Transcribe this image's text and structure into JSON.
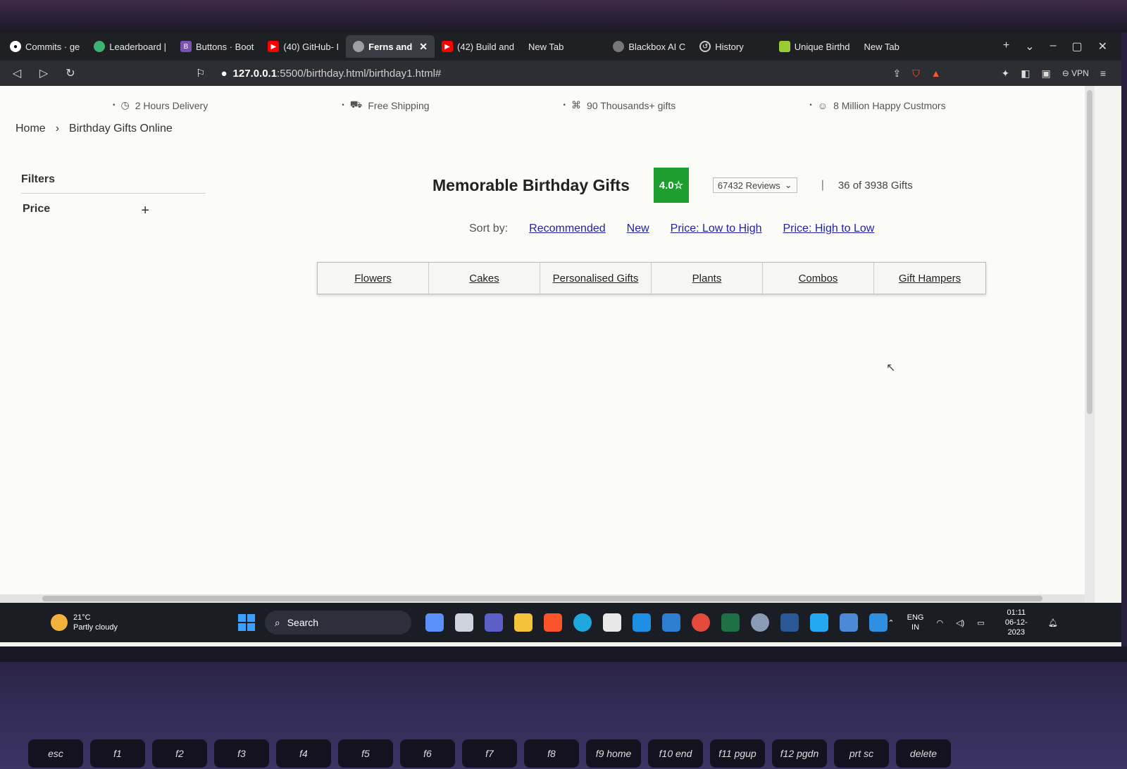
{
  "browser": {
    "tabs": [
      {
        "label": "Commits · ge",
        "icon": "github-icon",
        "color": "#ffffff"
      },
      {
        "label": "Leaderboard |",
        "icon": "leaderboard-icon",
        "color": "#3cb371"
      },
      {
        "label": "Buttons · Boot",
        "icon": "bootstrap-icon",
        "color": "#7952b3"
      },
      {
        "label": "(40) GitHub- I",
        "icon": "youtube-icon",
        "color": "#ff0000"
      },
      {
        "label": "Ferns and",
        "icon": "globe-icon",
        "color": "#9aa0a6",
        "active": true
      },
      {
        "label": "(42) Build and",
        "icon": "youtube-icon",
        "color": "#ff0000"
      },
      {
        "label": "New Tab",
        "icon": "",
        "color": ""
      },
      {
        "label": "Blackbox AI C",
        "icon": "blackbox-icon",
        "color": "#cccccc"
      },
      {
        "label": "History",
        "icon": "history-icon",
        "color": "#cccccc"
      },
      {
        "label": "Unique Birthd",
        "icon": "fnp-icon",
        "color": "#9acd32"
      },
      {
        "label": "New Tab",
        "icon": "",
        "color": ""
      }
    ],
    "url_host": "127.0.0.1",
    "url_path": ":5500/birthday.html/birthday1.html#",
    "vpn_label": "VPN"
  },
  "page": {
    "features": [
      {
        "label": "2 Hours Delivery",
        "icon": "clock-icon"
      },
      {
        "label": "Free Shipping",
        "icon": "truck-icon"
      },
      {
        "label": "90 Thousands+ gifts",
        "icon": "gift-icon"
      },
      {
        "label": "8 Million Happy Custmors",
        "icon": "smile-icon"
      }
    ],
    "breadcrumb": {
      "home": "Home",
      "current": "Birthday Gifts Online"
    },
    "filters": {
      "title": "Filters",
      "price": "Price",
      "expand": "+"
    },
    "heading": "Memorable Birthday Gifts",
    "rating": "4.0",
    "reviews": "67432 Reviews",
    "separator": "|",
    "gift_count": "36 of 3938 Gifts",
    "sort": {
      "label": "Sort by:",
      "options": [
        "Recommended",
        "New",
        "Price: Low to High",
        "Price: High to Low"
      ]
    },
    "categories": [
      "Flowers",
      "Cakes",
      "Personalised Gifts",
      "Plants",
      "Combos",
      "Gift Hampers"
    ]
  },
  "taskbar": {
    "temperature": "21°C",
    "weather": "Partly cloudy",
    "search": "Search",
    "lang_1": "ENG",
    "lang_2": "IN",
    "time": "01:11",
    "date": "06-12-2023"
  },
  "keyboard": [
    "esc",
    "f1",
    "f2",
    "f3",
    "f4",
    "f5",
    "f6",
    "f7",
    "f8",
    "f9 home",
    "f10 end",
    "f11 pgup",
    "f12 pgdn",
    "prt sc",
    "delete"
  ]
}
